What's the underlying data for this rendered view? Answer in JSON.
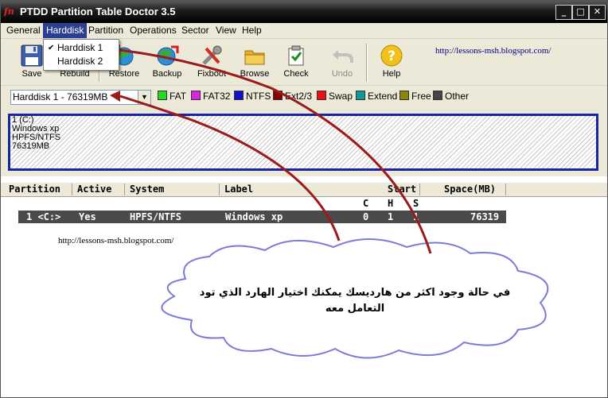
{
  "window": {
    "title": "PTDD Partition Table Doctor 3.5",
    "icon_text": "fn"
  },
  "window_buttons": [
    "_",
    "□",
    "✕"
  ],
  "menu": [
    "General",
    "Harddisk",
    "Partition",
    "Operations",
    "Sector",
    "View",
    "Help"
  ],
  "harddisk_menu": {
    "items": [
      {
        "label": "Harddisk 1",
        "checked": true
      },
      {
        "label": "Harddisk 2",
        "checked": false
      }
    ],
    "check_glyph": "✔"
  },
  "toolbar": [
    {
      "label": "Save",
      "icon": "floppy-icon",
      "enabled": true
    },
    {
      "label": "Rebuild",
      "icon": "rebuild-icon",
      "enabled": true
    },
    {
      "label": "Restore",
      "icon": "restore-icon",
      "enabled": true
    },
    {
      "label": "Backup",
      "icon": "backup-icon",
      "enabled": true
    },
    {
      "label": "Fixboot",
      "icon": "wrench-icon",
      "enabled": true
    },
    {
      "label": "Browse",
      "icon": "folder-icon",
      "enabled": true
    },
    {
      "label": "Check",
      "icon": "check-icon",
      "enabled": true
    },
    {
      "label": "Undo",
      "icon": "undo-icon",
      "enabled": false
    },
    {
      "label": "Help",
      "icon": "help-icon",
      "enabled": true
    }
  ],
  "link_text": "http://lessons-msh.blogspot.com/",
  "disk_select": {
    "value": "Harddisk 1 - 76319MB"
  },
  "legend": [
    {
      "label": "FAT",
      "color": "#22dd22"
    },
    {
      "label": "FAT32",
      "color": "#dd22dd"
    },
    {
      "label": "NTFS",
      "color": "#1111cc"
    },
    {
      "label": "Ext2/3",
      "color": "#880000"
    },
    {
      "label": "Swap",
      "color": "#ee1111"
    },
    {
      "label": "Extend",
      "color": "#119999"
    },
    {
      "label": "Free",
      "color": "#888800"
    },
    {
      "label": "Other",
      "color": "#444444"
    }
  ],
  "disk_block": {
    "lines": [
      "1 (C:)",
      "Windows xp",
      "HPFS/NTFS",
      "76319MB"
    ]
  },
  "table": {
    "columns": [
      "Partition",
      "Active",
      "System",
      "Label",
      "Start",
      "Space(MB)"
    ],
    "subheaders": [
      "C",
      "H",
      "S"
    ],
    "rows": [
      {
        "partition": "1 <C:>",
        "active": "Yes",
        "system": "HPFS/NTFS",
        "label": "Windows xp",
        "c": "0",
        "h": "1",
        "s": "1",
        "space": "76319"
      }
    ]
  },
  "annotation": {
    "line1": "في حالة وجود اكثر من هارديسك يمكنك اختيار الهارد الذي تود",
    "line2": "التعامل معه"
  },
  "colors": {
    "accent": "#2b3f92",
    "disk_border": "#1a23a0",
    "arrow": "#9b1a1a",
    "link": "#000080",
    "cloud_border": "#7b7bd8"
  }
}
